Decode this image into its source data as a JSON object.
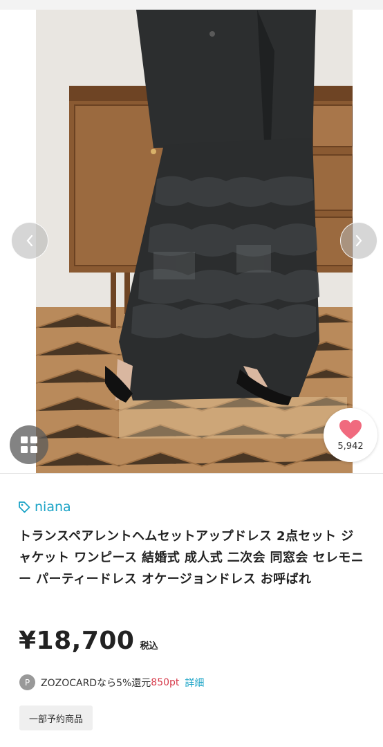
{
  "product": {
    "favorite_count": "5,942",
    "brand": "niana",
    "title": "トランスペアレントヘムセットアップドレス 2点セット ジャケット ワンピース 結婚式 成人式 二次会 同窓会 セレモニー パーティードレス オケージョンドレス お呼ばれ",
    "price": "¥18,700",
    "tax_label": "税込",
    "zozocard": {
      "badge": "P",
      "text": "ZOZOCARDなら5%還元",
      "points": "850pt",
      "detail_link": "詳細"
    },
    "tag": "一部予約商品"
  },
  "colors": {
    "brand_accent": "#1aa3c6",
    "points_red": "#d63a4a",
    "heart": "#f06a7e"
  },
  "icons": [
    "chevron-left-icon",
    "chevron-right-icon",
    "grid-icon",
    "heart-icon",
    "tag-icon"
  ]
}
